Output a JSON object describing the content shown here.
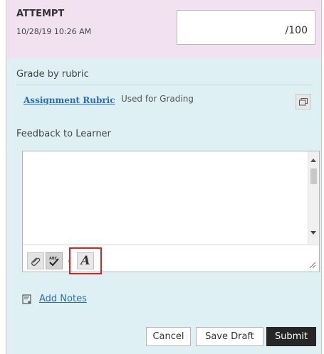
{
  "attempt": {
    "title": "ATTEMPT",
    "date": "10/28/19 10:26 AM",
    "grade_value": "/100"
  },
  "grading": {
    "grade_by_rubric_label": "Grade by rubric",
    "rubric_link": "Assignment Rubric",
    "rubric_note": "Used for Grading"
  },
  "feedback": {
    "label": "Feedback to Learner",
    "text": ""
  },
  "toolbar": {
    "attach_icon": "paperclip-icon",
    "spellcheck_icon": "spellcheck-icon",
    "font_icon": "font-icon",
    "font_label": "A"
  },
  "notes": {
    "link": "Add Notes",
    "icon": "notes-icon"
  },
  "actions": {
    "cancel": "Cancel",
    "save_draft": "Save Draft",
    "submit": "Submit"
  },
  "colors": {
    "attempt_bg": "#f1e1f1",
    "body_bg": "#def0f4",
    "link": "#2a6db5",
    "submit_bg": "#262626",
    "highlight": "#e02121"
  }
}
